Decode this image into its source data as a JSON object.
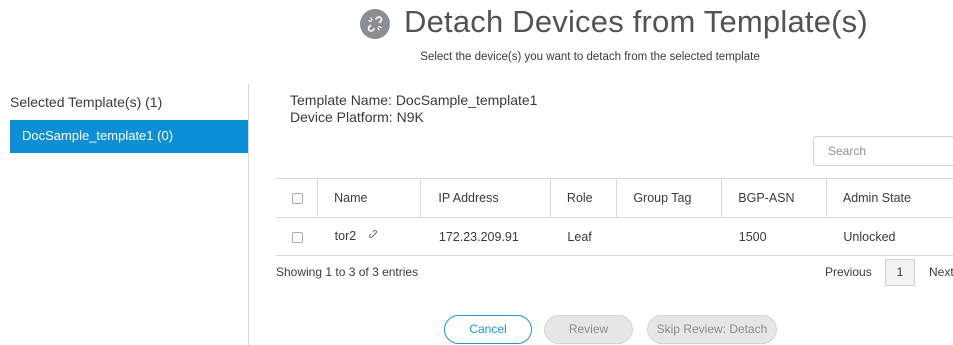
{
  "dialog": {
    "title": "Detach Devices from Template(s)",
    "subtitle": "Select the device(s) you want to detach from the selected template",
    "title_icon": "broken-link-icon"
  },
  "sidebar": {
    "heading": "Selected Template(s) (1)",
    "items": [
      {
        "label": "DocSample_template1 (0)",
        "selected": true
      }
    ]
  },
  "template_info": {
    "name_line": "Template Name: DocSample_template1",
    "platform_line": "Device Platform: N9K"
  },
  "search": {
    "placeholder": "Search"
  },
  "table": {
    "headers": [
      "Name",
      "IP Address",
      "Role",
      "Group Tag",
      "BGP-ASN",
      "Admin State"
    ],
    "rows": [
      {
        "name": "tor2",
        "ip": "172.23.209.91",
        "role": "Leaf",
        "group_tag": "",
        "bgp_asn": "1500",
        "admin_state": "Unlocked",
        "row_icon": "link-icon"
      }
    ]
  },
  "pagination": {
    "showing": "Showing 1 to 3 of 3 entries",
    "previous": "Previous",
    "current_page": "1",
    "next": "Next"
  },
  "buttons": {
    "cancel": "Cancel",
    "review": "Review",
    "skip": "Skip Review: Detach"
  },
  "colors": {
    "accent": "#0d8fd6",
    "cancel_border": "#1e96da",
    "disabled_bg": "#e6e6e7",
    "divider": "#d8dadd"
  }
}
